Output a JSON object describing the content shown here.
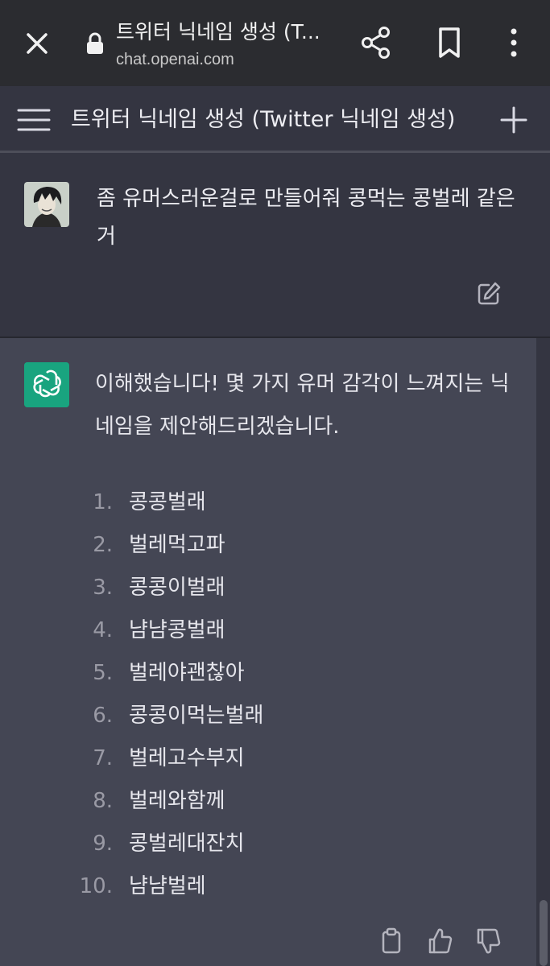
{
  "browser": {
    "tab_title": "트위터 닉네임 생성 (T...",
    "url": "chat.openai.com",
    "icons": [
      "close-icon",
      "lock-icon",
      "share-icon",
      "bookmark-icon",
      "more-vert-icon"
    ]
  },
  "header": {
    "title": "트위터 닉네임 생성 (Twitter 닉네임 생성)",
    "icons": [
      "menu-icon",
      "plus-icon"
    ]
  },
  "user_message": {
    "text": "좀 유머스러운걸로 만들어줘 콩먹는 콩벌레 같은거"
  },
  "assistant_message": {
    "intro": "이해했습니다! 몇 가지 유머 감각이 느껴지는 닉네임을 제안해드리겠습니다.",
    "items": [
      {
        "num": "1.",
        "text": "콩콩벌래"
      },
      {
        "num": "2.",
        "text": "벌레먹고파"
      },
      {
        "num": "3.",
        "text": "콩콩이벌래"
      },
      {
        "num": "4.",
        "text": "냠냠콩벌래"
      },
      {
        "num": "5.",
        "text": "벌레야괜찮아"
      },
      {
        "num": "6.",
        "text": "콩콩이먹는벌래"
      },
      {
        "num": "7.",
        "text": "벌레고수부지"
      },
      {
        "num": "8.",
        "text": "벌레와함께"
      },
      {
        "num": "9.",
        "text": "콩벌레대잔치"
      },
      {
        "num": "10.",
        "text": "냠냠벌레"
      }
    ],
    "actions": [
      "clipboard-icon",
      "thumbs-up-icon",
      "thumbs-down-icon"
    ]
  },
  "colors": {
    "browser_bar": "#2b2c30",
    "background": "#343541",
    "assistant_bg": "#444654",
    "openai_green": "#19a47f"
  }
}
